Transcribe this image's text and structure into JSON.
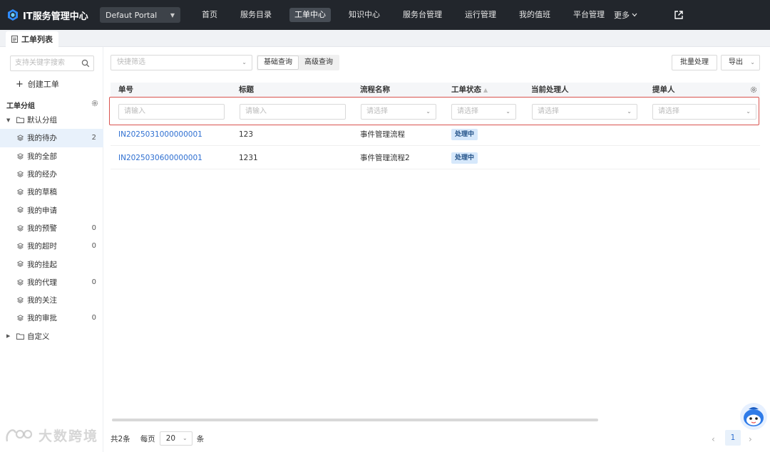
{
  "topbar": {
    "app_title": "IT服务管理中心",
    "portal": "Defaut Portal",
    "nav": [
      "首页",
      "服务目录",
      "工单中心",
      "知识中心",
      "服务台管理",
      "运行管理",
      "我的值班",
      "平台管理"
    ],
    "active_nav": "工单中心",
    "more": "更多"
  },
  "tabbar": {
    "tab": "工单列表"
  },
  "sidebar": {
    "search_placeholder": "支持关键字搜索",
    "create": "创建工单",
    "group_title": "工单分组",
    "default_group": "默认分组",
    "custom_group": "自定义",
    "items": [
      {
        "label": "我的待办",
        "count": "2"
      },
      {
        "label": "我的全部",
        "count": ""
      },
      {
        "label": "我的经办",
        "count": ""
      },
      {
        "label": "我的草稿",
        "count": ""
      },
      {
        "label": "我的申请",
        "count": ""
      },
      {
        "label": "我的预警",
        "count": "0"
      },
      {
        "label": "我的超时",
        "count": "0"
      },
      {
        "label": "我的挂起",
        "count": ""
      },
      {
        "label": "我的代理",
        "count": "0"
      },
      {
        "label": "我的关注",
        "count": ""
      },
      {
        "label": "我的审批",
        "count": "0"
      }
    ]
  },
  "toolbar": {
    "quick_filter_placeholder": "快捷筛选",
    "basic_query": "基础查询",
    "advanced_query": "高级查询",
    "batch": "批量处理",
    "export": "导出"
  },
  "table": {
    "columns": [
      "单号",
      "标题",
      "流程名称",
      "工单状态",
      "当前处理人",
      "提单人"
    ],
    "filters": {
      "input_placeholder": "请输入",
      "select_placeholder": "请选择"
    },
    "rows": [
      {
        "no": "IN2025031000000001",
        "title": "123",
        "process": "事件管理流程",
        "status": "处理中"
      },
      {
        "no": "IN2025030600000001",
        "title": "1231",
        "process": "事件管理流程2",
        "status": "处理中"
      }
    ]
  },
  "pager": {
    "total": "共2条",
    "per_page": "每页",
    "size": "20",
    "unit": "条",
    "current": "1"
  },
  "watermark": "大数跨境",
  "colors": {
    "topbar": "#22262c",
    "link": "#2e6fd1",
    "highlight_border": "#d9534f",
    "badge_bg": "#d6e8fb"
  }
}
